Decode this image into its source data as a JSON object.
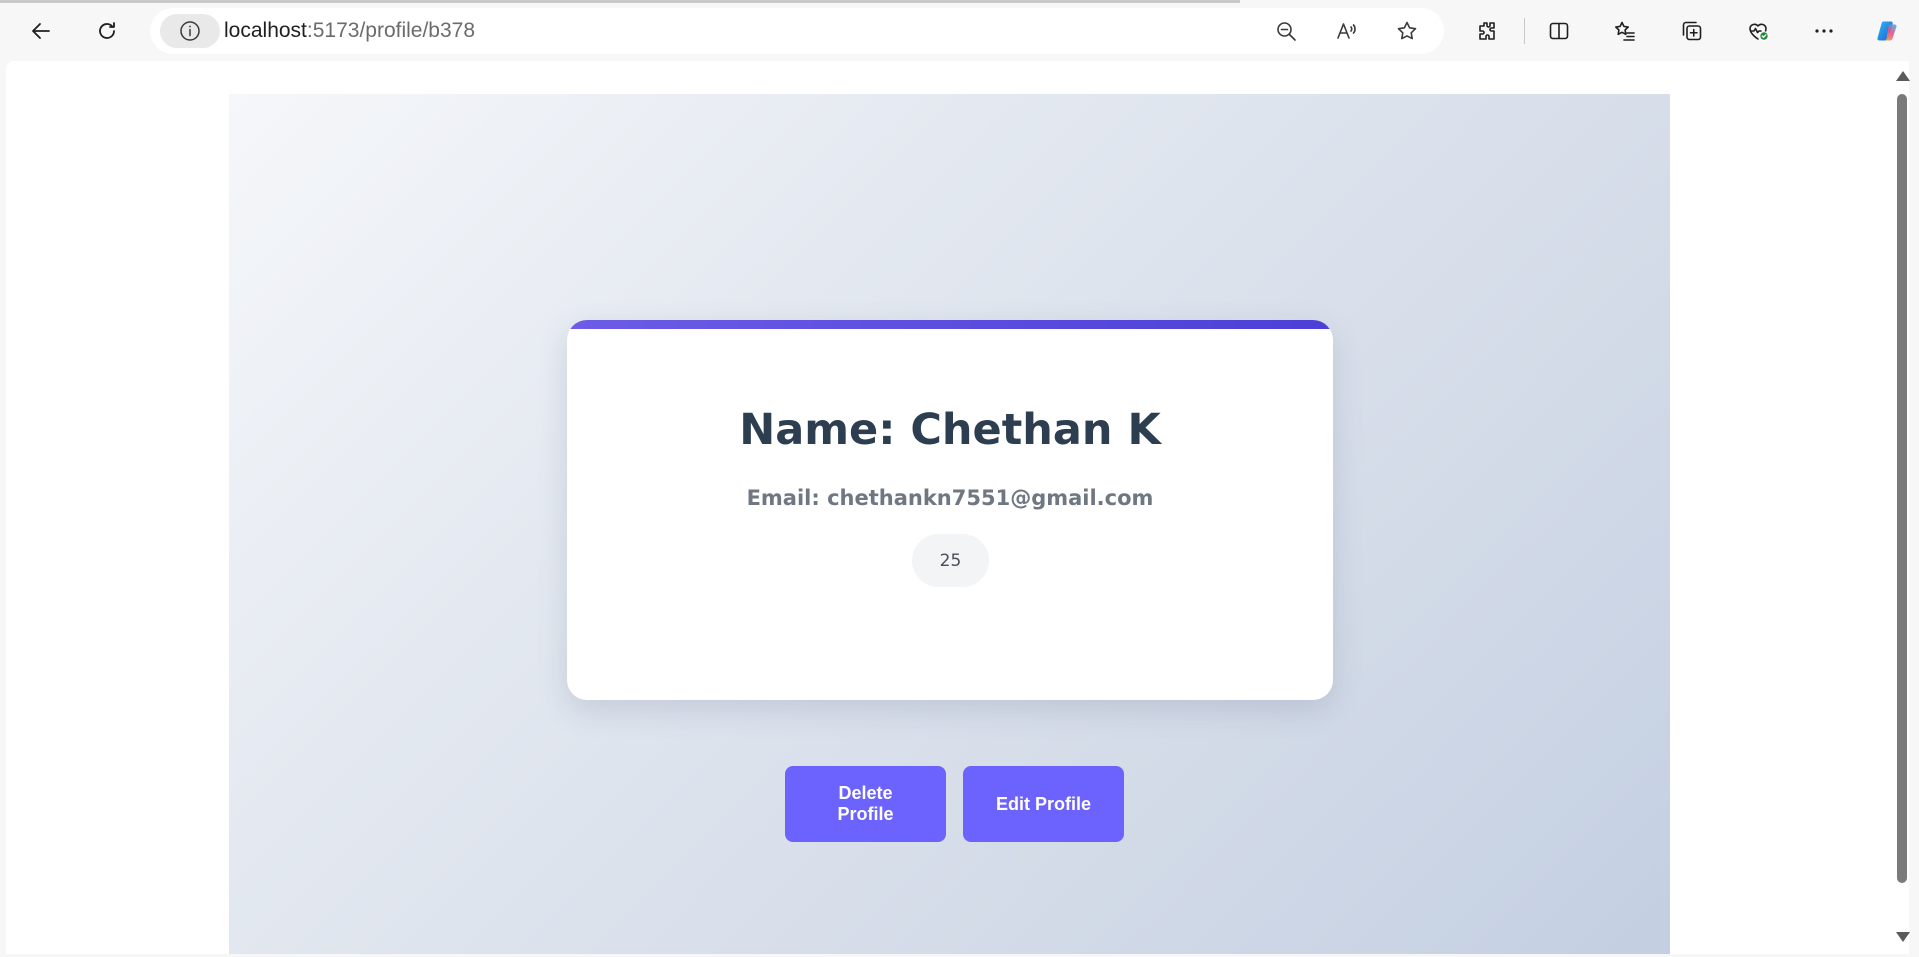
{
  "browser": {
    "url_host": "localhost",
    "url_path": ":5173/profile/b378",
    "icons": [
      "back-icon",
      "refresh-icon",
      "site-info-icon",
      "zoom-out-icon",
      "read-aloud-icon",
      "favorite-star-icon",
      "extensions-icon",
      "split-screen-icon",
      "favorites-list-icon",
      "collections-icon",
      "browser-essentials-icon",
      "more-icon",
      "copilot-icon"
    ]
  },
  "profile": {
    "name": "Name: Chethan K",
    "email": "Email: chethankn7551@gmail.com",
    "age": "25"
  },
  "actions": {
    "delete_label": "Delete Profile",
    "edit_label": "Edit Profile"
  },
  "colors": {
    "accent": "#6c63ff",
    "card_accent_start": "#6c5ce7",
    "card_accent_end": "#4b3fd6",
    "heading": "#2d3e50",
    "email": "#6f7782"
  }
}
